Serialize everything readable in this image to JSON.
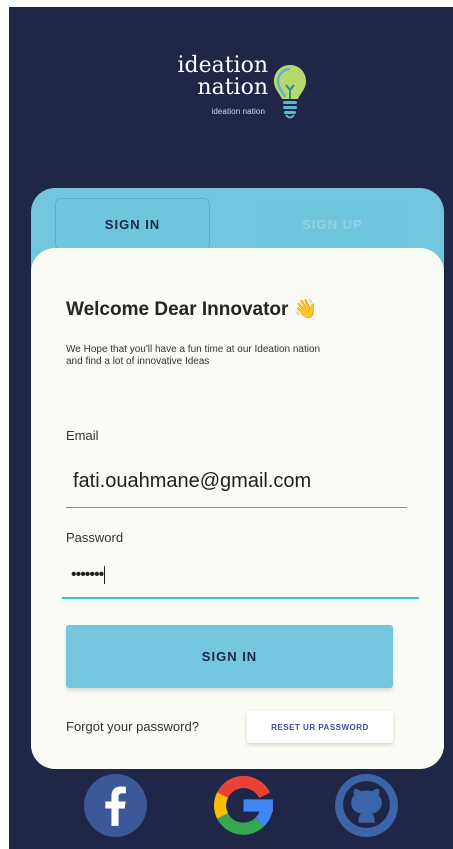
{
  "logo": {
    "title_line1": "ideation",
    "title_line2": "nation",
    "subtitle": "ideation nation"
  },
  "tabs": [
    {
      "label": "SIGN IN",
      "active": true
    },
    {
      "label": "SIGN UP",
      "active": false
    }
  ],
  "welcome": {
    "title": "Welcome Dear Innovator 👋",
    "description": "We Hope that you'll have a fun time at our Ideation nation and find a lot of innovative Ideas"
  },
  "form": {
    "email_label": "Email",
    "email_value": "fati.ouahmane@gmail.com",
    "password_label": "Password",
    "password_value": "•••••••"
  },
  "buttons": {
    "signin_label": "SIGN IN",
    "forgot_text": "Forgot your password?",
    "reset_label": "RESET UR PASSWORD"
  },
  "social": [
    {
      "icon": "facebook-icon"
    },
    {
      "icon": "google-icon"
    },
    {
      "icon": "github-icon"
    }
  ],
  "colors": {
    "background": "#202648",
    "card_accent": "#72c6dc",
    "card_surface": "#fbfbf5",
    "input_focus": "#2cc9d3"
  }
}
